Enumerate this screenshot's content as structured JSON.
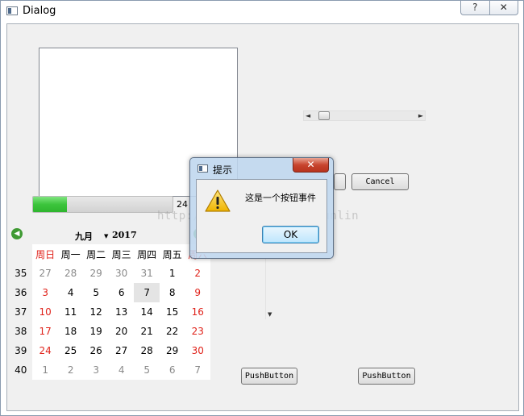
{
  "window": {
    "title": "Dialog",
    "help_glyph": "?",
    "close_glyph": "✕"
  },
  "progress": {
    "value": 24,
    "fraction": 0.24,
    "text": "24"
  },
  "hscroll": {
    "left_arrow": "◄",
    "right_arrow": "►",
    "position_fraction": 0.1
  },
  "vscroll": {
    "down_arrow": "▼"
  },
  "buttons": {
    "cancel": "Cancel",
    "push1": "PushButton",
    "push2": "PushButton"
  },
  "calendar": {
    "month": "九月",
    "year": "2017",
    "prev_glyph": "◀",
    "next_glyph": "▶",
    "headers": [
      "周日",
      "周一",
      "周二",
      "周三",
      "周四",
      "周五",
      "周六"
    ],
    "weeks": [
      {
        "num": "35",
        "days": [
          "27",
          "28",
          "29",
          "30",
          "31",
          "1",
          "2"
        ]
      },
      {
        "num": "36",
        "days": [
          "3",
          "4",
          "5",
          "6",
          "7",
          "8",
          "9"
        ]
      },
      {
        "num": "37",
        "days": [
          "10",
          "11",
          "12",
          "13",
          "14",
          "15",
          "16"
        ]
      },
      {
        "num": "38",
        "days": [
          "17",
          "18",
          "19",
          "20",
          "21",
          "22",
          "23"
        ]
      },
      {
        "num": "39",
        "days": [
          "24",
          "25",
          "26",
          "27",
          "28",
          "29",
          "30"
        ]
      },
      {
        "num": "40",
        "days": [
          "1",
          "2",
          "3",
          "4",
          "5",
          "6",
          "7"
        ]
      }
    ],
    "selected": "7",
    "weekend_color": "#e0231b",
    "other_month_color": "#8a8a8a"
  },
  "message_box": {
    "title": "提示",
    "text": "这是一个按钮事件",
    "ok": "OK",
    "close_glyph": "✕",
    "icon": "warning-icon"
  },
  "watermark": "http://blog.csdn.net/gcunlin"
}
